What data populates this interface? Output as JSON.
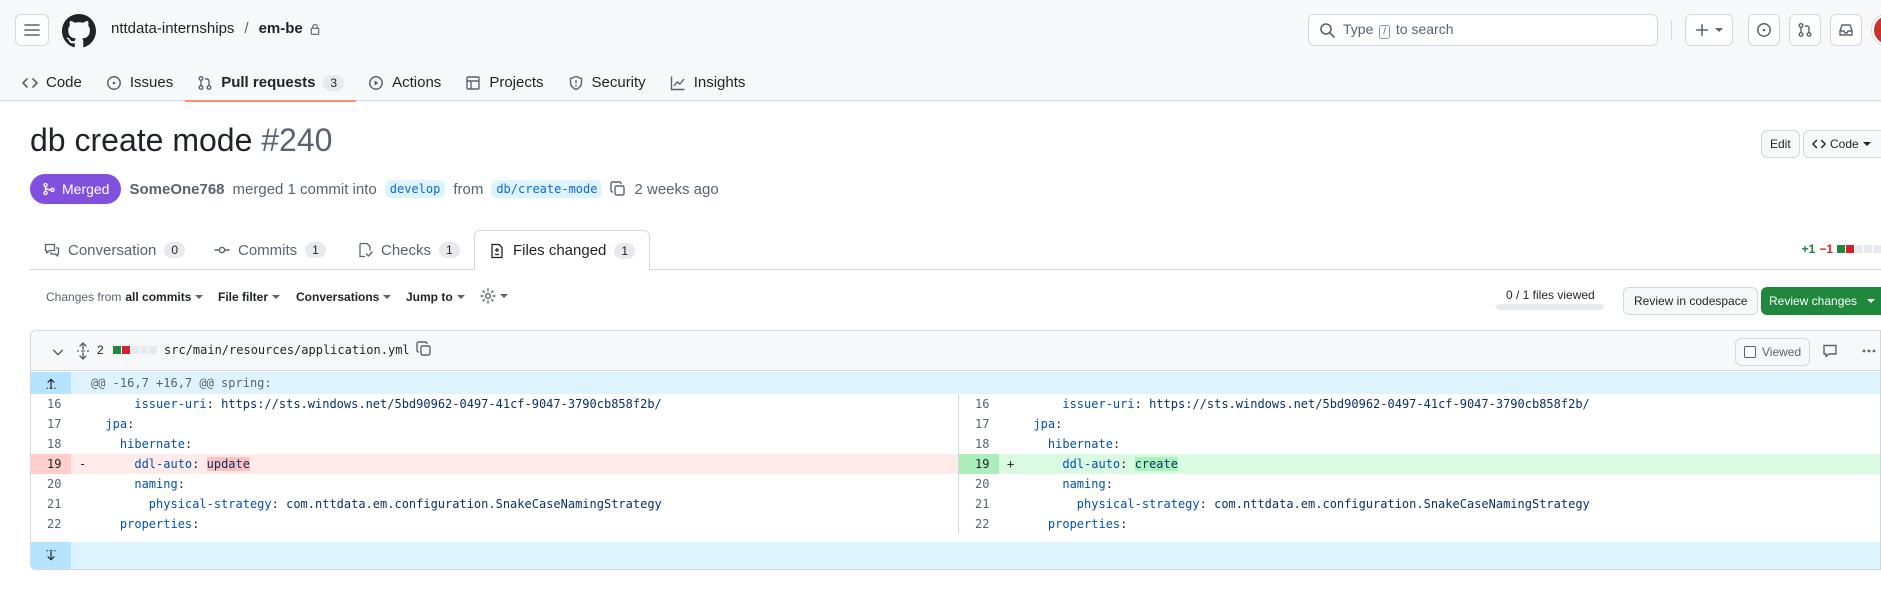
{
  "header": {
    "owner": "nttdata-internships",
    "separator": "/",
    "repo": "em-be",
    "search_prefix": "Type",
    "search_key": "/",
    "search_suffix": "to search"
  },
  "repo_nav": [
    {
      "label": "Code",
      "icon": "code-icon"
    },
    {
      "label": "Issues",
      "icon": "issue-icon"
    },
    {
      "label": "Pull requests",
      "icon": "pull-request-icon",
      "count": "3"
    },
    {
      "label": "Actions",
      "icon": "play-icon"
    },
    {
      "label": "Projects",
      "icon": "table-icon"
    },
    {
      "label": "Security",
      "icon": "shield-icon"
    },
    {
      "label": "Insights",
      "icon": "graph-icon"
    }
  ],
  "pr": {
    "title": "db create mode",
    "number": "#240",
    "edit_label": "Edit",
    "code_label": "Code",
    "state": "Merged",
    "author": "SomeOne768",
    "action": "merged 1 commit into",
    "base_branch": "develop",
    "from_word": "from",
    "head_branch": "db/create-mode",
    "time": "2 weeks ago"
  },
  "pr_tabs": [
    {
      "label": "Conversation",
      "count": "0"
    },
    {
      "label": "Commits",
      "count": "1"
    },
    {
      "label": "Checks",
      "count": "1"
    },
    {
      "label": "Files changed",
      "count": "1"
    }
  ],
  "diffstat": {
    "additions": "+1",
    "deletions": "−1"
  },
  "toolbar": {
    "changes_from_prefix": "Changes from",
    "changes_from_value": "all commits",
    "file_filter": "File filter",
    "conversations": "Conversations",
    "jump_to": "Jump to",
    "files_viewed": "0 / 1 files viewed",
    "review_codespace": "Review in codespace",
    "review_changes": "Review changes"
  },
  "file": {
    "changes": "2",
    "path": "src/main/resources/application.yml",
    "viewed_label": "Viewed",
    "hunk_header": "@@ -16,7 +16,7 @@ spring:"
  },
  "diff_left": [
    {
      "n": "16",
      "indent": "      ",
      "key": "issuer-uri",
      "val": "https://sts.windows.net/5bd90962-0497-41cf-9047-3790cb858f2b/",
      "type": "ctx"
    },
    {
      "n": "17",
      "indent": "  ",
      "key": "jpa",
      "val": "",
      "type": "ctx"
    },
    {
      "n": "18",
      "indent": "    ",
      "key": "hibernate",
      "val": "",
      "type": "ctx"
    },
    {
      "n": "19",
      "indent": "      ",
      "key": "ddl-auto",
      "val": "update",
      "type": "del",
      "marker": "-"
    },
    {
      "n": "20",
      "indent": "      ",
      "key": "naming",
      "val": "",
      "type": "ctx"
    },
    {
      "n": "21",
      "indent": "        ",
      "key": "physical-strategy",
      "val": "com.nttdata.em.configuration.SnakeCaseNamingStrategy",
      "type": "ctx"
    },
    {
      "n": "22",
      "indent": "    ",
      "key": "properties",
      "val": "",
      "type": "ctx"
    }
  ],
  "diff_right": [
    {
      "n": "16",
      "indent": "      ",
      "key": "issuer-uri",
      "val": "https://sts.windows.net/5bd90962-0497-41cf-9047-3790cb858f2b/",
      "type": "ctx"
    },
    {
      "n": "17",
      "indent": "  ",
      "key": "jpa",
      "val": "",
      "type": "ctx"
    },
    {
      "n": "18",
      "indent": "    ",
      "key": "hibernate",
      "val": "",
      "type": "ctx"
    },
    {
      "n": "19",
      "indent": "      ",
      "key": "ddl-auto",
      "val": "create",
      "type": "add",
      "marker": "+"
    },
    {
      "n": "20",
      "indent": "      ",
      "key": "naming",
      "val": "",
      "type": "ctx"
    },
    {
      "n": "21",
      "indent": "        ",
      "key": "physical-strategy",
      "val": "com.nttdata.em.configuration.SnakeCaseNamingStrategy",
      "type": "ctx"
    },
    {
      "n": "22",
      "indent": "    ",
      "key": "properties",
      "val": "",
      "type": "ctx"
    }
  ],
  "colors": {
    "merged": "#8250df",
    "primary_button": "#1f883d",
    "addition": "#1a7f37",
    "deletion": "#d1242f",
    "tab_underline": "#fd8c73"
  }
}
